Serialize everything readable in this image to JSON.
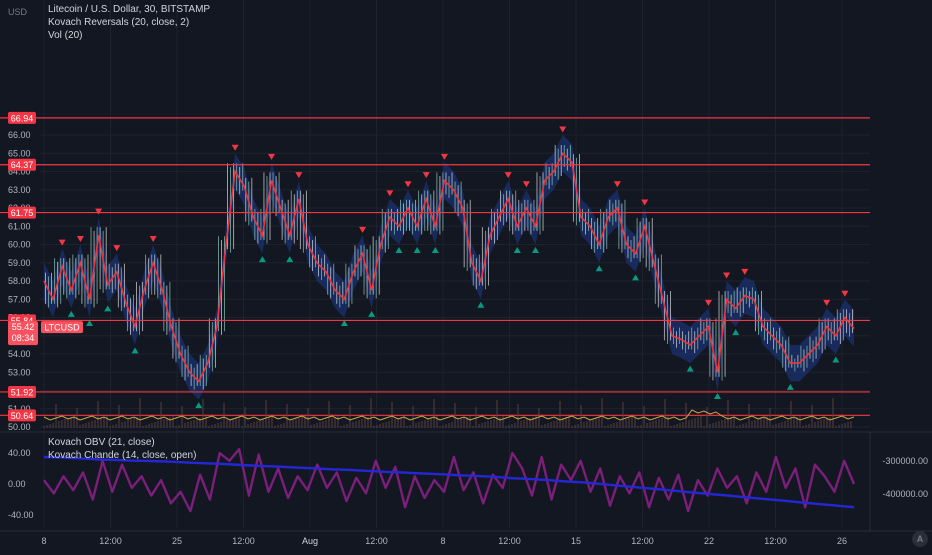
{
  "header": {
    "currency": "USD",
    "title": "Litecoin / U.S. Dollar, 30, BITSTAMP",
    "indicator1": "Kovach Reversals (20, close, 2)",
    "indicator2": "Vol (20)"
  },
  "lower_pane": {
    "indicator1": "Kovach OBV (21, close)",
    "indicator2": "Kovach Chande (14, close, open)"
  },
  "price_axis": {
    "ticks": [
      "66.00",
      "65.00",
      "64.00",
      "63.00",
      "62.00",
      "61.00",
      "60.00",
      "59.00",
      "58.00",
      "57.00",
      "56.00",
      "55.00",
      "54.00",
      "53.00",
      "52.00",
      "51.00",
      "50.00"
    ],
    "level_labels": [
      "66.94",
      "64.37",
      "61.75",
      "55.84",
      "51.92",
      "50.64"
    ],
    "last_price": "55.42",
    "symbol": "LTCUSD",
    "countdown": "08:34"
  },
  "lower_axis": {
    "left_ticks": [
      "40.00",
      "0.00",
      "-40.00"
    ],
    "right_ticks": [
      "-300000.00",
      "-400000.00"
    ]
  },
  "time_axis": {
    "ticks": [
      "8",
      "12:00",
      "25",
      "12:00",
      "Aug",
      "12:00",
      "8",
      "12:00",
      "15",
      "12:00",
      "22",
      "12:00",
      "26"
    ]
  },
  "colors": {
    "background": "#131722",
    "level_line": "#f23645",
    "up_marker": "#089981",
    "down_marker": "#f23645",
    "obv_line": "#2427d6",
    "chande_line": "#7b1f7b",
    "band": "#1e3a8a"
  },
  "branding": {
    "logo_letter": "A"
  },
  "chart_data": [
    {
      "type": "line",
      "title": "Litecoin / U.S. Dollar, 30, BITSTAMP",
      "ylabel": "USD",
      "ylim": [
        49.8,
        67.6
      ],
      "x_ticks": [
        "8",
        "12:00",
        "25",
        "12:00",
        "Aug",
        "12:00",
        "8",
        "12:00",
        "15",
        "12:00",
        "22",
        "12:00",
        "26"
      ],
      "series": [
        {
          "name": "LTCUSD",
          "values": [
            58.0,
            57.0,
            58.8,
            57.5,
            59.0,
            57.0,
            60.5,
            57.8,
            58.5,
            56.8,
            55.5,
            57.5,
            59.0,
            57.5,
            55.5,
            54.0,
            53.0,
            52.5,
            53.5,
            55.5,
            60.0,
            64.0,
            63.2,
            61.5,
            60.5,
            63.5,
            62.0,
            60.5,
            62.5,
            60.0,
            59.0,
            58.5,
            57.5,
            57.0,
            58.5,
            59.5,
            57.5,
            60.0,
            61.5,
            61.0,
            62.0,
            61.0,
            62.5,
            61.0,
            63.5,
            63.0,
            62.0,
            59.0,
            58.0,
            60.5,
            61.5,
            62.5,
            61.0,
            62.0,
            61.0,
            63.5,
            64.0,
            65.0,
            64.5,
            61.5,
            61.0,
            60.0,
            61.5,
            62.0,
            60.0,
            59.5,
            61.0,
            59.0,
            57.0,
            55.0,
            54.8,
            54.5,
            55.0,
            55.5,
            53.0,
            57.0,
            56.5,
            57.2,
            57.0,
            55.5,
            55.0,
            54.5,
            53.5,
            53.5,
            54.0,
            54.5,
            55.5,
            55.0,
            56.0,
            55.4
          ]
        }
      ],
      "levels": [
        66.94,
        64.37,
        61.75,
        55.84,
        51.92,
        50.64
      ],
      "last_price": 55.42
    },
    {
      "type": "line",
      "ylim_left": [
        -55,
        55
      ],
      "ylim_right": [
        -460000,
        -260000
      ],
      "series": [
        {
          "name": "Kovach OBV (21, close)",
          "axis": "right",
          "values": [
            -288000,
            -289000,
            -292000,
            -295000,
            -297000,
            -299000,
            -300000,
            -302000,
            -305000,
            -307000,
            -309000,
            -312000,
            -315000,
            -317000,
            -320000,
            -322000,
            -325000,
            -327000,
            -330000,
            -333000,
            -335000,
            -338000,
            -340000,
            -343000,
            -345000,
            -348000,
            -352000,
            -355000,
            -358000,
            -362000,
            -365000,
            -370000,
            -375000,
            -380000,
            -385000,
            -390000,
            -395000,
            -400000,
            -405000,
            -410000,
            -415000,
            -420000,
            -425000,
            -430000,
            -435000,
            -440000
          ]
        },
        {
          "name": "Kovach Chande (14, close, open)",
          "axis": "left",
          "values": [
            5,
            -12,
            10,
            -8,
            15,
            -20,
            30,
            -10,
            25,
            -5,
            10,
            -15,
            5,
            -25,
            -10,
            -35,
            12,
            -20,
            40,
            30,
            45,
            -15,
            38,
            -10,
            20,
            -18,
            10,
            -8,
            25,
            -5,
            15,
            -22,
            8,
            -12,
            30,
            -5,
            22,
            -30,
            10,
            -18,
            5,
            -10,
            35,
            -8,
            15,
            -25,
            12,
            -5,
            40,
            20,
            -15,
            35,
            -20,
            25,
            5,
            30,
            -10,
            20,
            -28,
            10,
            -12,
            15,
            -30,
            8,
            -20,
            12,
            -35,
            5,
            -15,
            20,
            -5,
            10,
            -25,
            15,
            -10,
            35,
            -5,
            20,
            -30,
            25,
            10,
            -10,
            30,
            0
          ]
        }
      ]
    }
  ]
}
